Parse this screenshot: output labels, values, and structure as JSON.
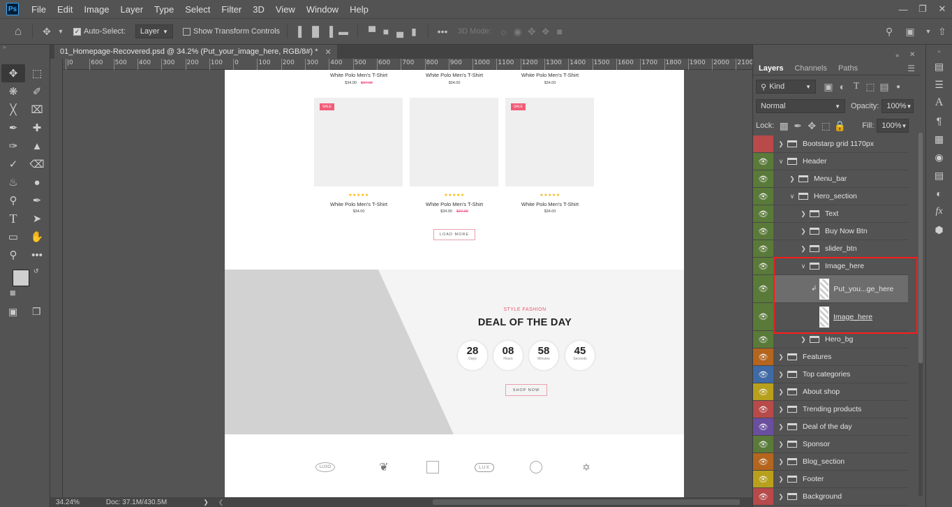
{
  "app": {
    "logo": "Ps",
    "menu": [
      "File",
      "Edit",
      "Image",
      "Layer",
      "Type",
      "Select",
      "Filter",
      "3D",
      "View",
      "Window",
      "Help"
    ],
    "window_controls": [
      "minimize-icon",
      "restore-icon",
      "close-icon"
    ]
  },
  "options_bar": {
    "auto_select_label": "Auto-Select:",
    "auto_select_checked": true,
    "auto_select_target": "Layer",
    "show_transform_label": "Show Transform Controls",
    "show_transform_checked": false,
    "mode_3d_label": "3D Mode:"
  },
  "document": {
    "tab_title": "01_Homepage-Recovered.psd @ 34.2% (Put_your_image_here, RGB/8#) *",
    "ruler_labels": [
      "|0",
      "600",
      "500",
      "400",
      "300",
      "200",
      "100",
      "0",
      "100",
      "200",
      "300",
      "400",
      "500",
      "600",
      "700",
      "800",
      "900",
      "1000",
      "1100",
      "1200",
      "1300",
      "1400",
      "1500",
      "1600",
      "1700",
      "1800",
      "1900",
      "2000",
      "2100"
    ],
    "status": {
      "zoom": "34.24%",
      "doc": "Doc: 37.1M/430.5M"
    }
  },
  "canvas": {
    "top_products": [
      {
        "name": "White Polo Men's T-Shirt",
        "price": "$34.00",
        "old_price": "$37.00"
      },
      {
        "name": "White Polo Men's T-Shirt",
        "price": "$34.00",
        "old_price": ""
      },
      {
        "name": "White Polo Men's T-Shirt",
        "price": "$34.00",
        "old_price": ""
      }
    ],
    "products": [
      {
        "sale": "SALE",
        "stars": "★★★★★",
        "name": "White Polo Men's T-Shirt",
        "price": "$34.00",
        "old_price": ""
      },
      {
        "sale": "",
        "stars": "★★★★★",
        "name": "White Polo Men's T-Shirt",
        "price": "$34.00",
        "old_price": "$37.00"
      },
      {
        "sale": "SALE",
        "stars": "★★★★★",
        "name": "White Polo Men's T-Shirt",
        "price": "$34.00",
        "old_price": ""
      }
    ],
    "load_more": "LOAD MORE",
    "deal": {
      "tag": "STYLE FASHION",
      "title": "DEAL OF THE DAY",
      "countdown": [
        {
          "value": "28",
          "label": "Days"
        },
        {
          "value": "08",
          "label": "Hours"
        },
        {
          "value": "58",
          "label": "Minutes"
        },
        {
          "value": "45",
          "label": "Seconds"
        }
      ],
      "button": "SHOP NOW"
    },
    "brands": [
      "LUXO",
      "",
      "",
      "LUX",
      "",
      ""
    ]
  },
  "layers_panel": {
    "tabs": [
      "Layers",
      "Channels",
      "Paths"
    ],
    "filter_kind": "Kind",
    "blend_mode": "Normal",
    "opacity_label": "Opacity:",
    "opacity_value": "100%",
    "lock_label": "Lock:",
    "fill_label": "Fill:",
    "fill_value": "100%",
    "layers": [
      {
        "name": "Bootstarp grid 1170px",
        "indent": 0,
        "expanded": false,
        "type": "folder",
        "color": "#b84a4a",
        "visible": false
      },
      {
        "name": "Header",
        "indent": 0,
        "expanded": true,
        "type": "folder",
        "color": "#5a7a3a",
        "visible": true
      },
      {
        "name": "Menu_bar",
        "indent": 1,
        "expanded": false,
        "type": "folder",
        "color": "#5a7a3a",
        "visible": true
      },
      {
        "name": "Hero_section",
        "indent": 1,
        "expanded": true,
        "type": "folder",
        "color": "#5a7a3a",
        "visible": true
      },
      {
        "name": "Text",
        "indent": 2,
        "expanded": false,
        "type": "folder",
        "color": "#5a7a3a",
        "visible": true
      },
      {
        "name": "Buy Now Btn",
        "indent": 2,
        "expanded": false,
        "type": "folder",
        "color": "#5a7a3a",
        "visible": true
      },
      {
        "name": "slider_btn",
        "indent": 2,
        "expanded": false,
        "type": "folder",
        "color": "#5a7a3a",
        "visible": true
      },
      {
        "name": "Image_here",
        "indent": 2,
        "expanded": true,
        "type": "folder",
        "color": "#5a7a3a",
        "visible": true
      },
      {
        "name": "Put_you...ge_here",
        "indent": 3,
        "expanded": false,
        "type": "smart",
        "color": "#5a7a3a",
        "visible": true,
        "selected": true
      },
      {
        "name": "Image_here",
        "indent": 3,
        "expanded": false,
        "type": "smart",
        "color": "#5a7a3a",
        "visible": true
      },
      {
        "name": "Hero_bg",
        "indent": 2,
        "expanded": false,
        "type": "folder",
        "color": "#5a7a3a",
        "visible": true
      },
      {
        "name": "Features",
        "indent": 0,
        "expanded": false,
        "type": "folder",
        "color": "#b5651d",
        "visible": true
      },
      {
        "name": "Top categories",
        "indent": 0,
        "expanded": false,
        "type": "folder",
        "color": "#3f6aa6",
        "visible": true
      },
      {
        "name": "About shop",
        "indent": 0,
        "expanded": false,
        "type": "folder",
        "color": "#b8a01d",
        "visible": true
      },
      {
        "name": "Trending products",
        "indent": 0,
        "expanded": false,
        "type": "folder",
        "color": "#b84a4a",
        "visible": true
      },
      {
        "name": "Deal of the day",
        "indent": 0,
        "expanded": false,
        "type": "folder",
        "color": "#6a4ea0",
        "visible": true
      },
      {
        "name": "Sponsor",
        "indent": 0,
        "expanded": false,
        "type": "folder",
        "color": "#5a7a3a",
        "visible": true
      },
      {
        "name": "Blog_section",
        "indent": 0,
        "expanded": false,
        "type": "folder",
        "color": "#b5651d",
        "visible": true
      },
      {
        "name": "Footer",
        "indent": 0,
        "expanded": false,
        "type": "folder",
        "color": "#b8a01d",
        "visible": true
      },
      {
        "name": "Background",
        "indent": 0,
        "expanded": false,
        "type": "folder",
        "color": "#b84a4a",
        "visible": true
      }
    ]
  },
  "colors": {
    "highlight": "#ff1a1a",
    "accent": "#e85a74"
  }
}
